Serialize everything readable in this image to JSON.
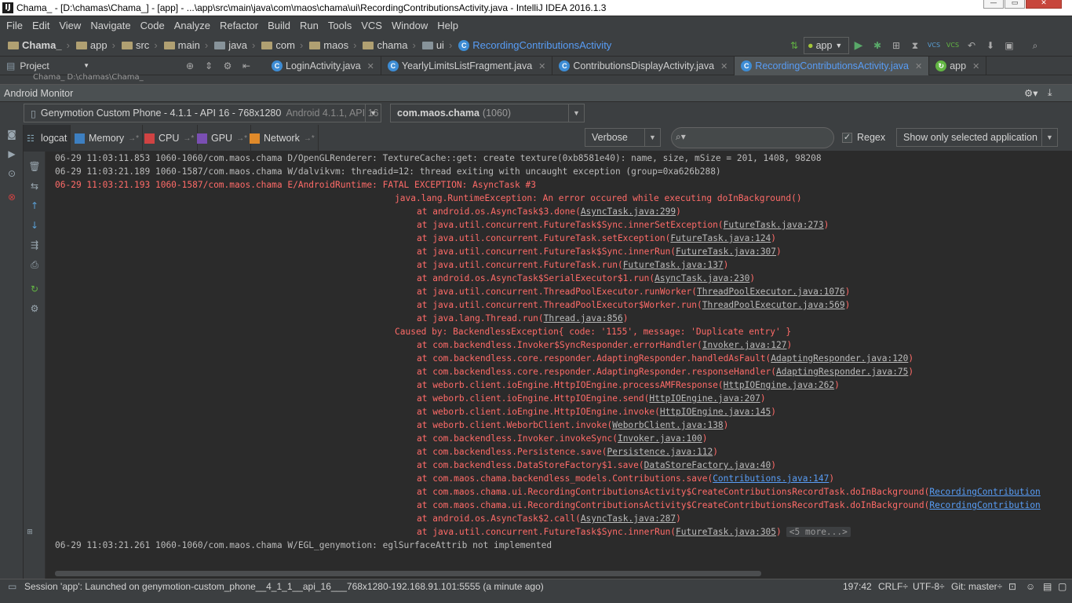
{
  "window": {
    "title": "Chama_ - [D:\\chamas\\Chama_] - [app] - ...\\app\\src\\main\\java\\com\\maos\\chama\\ui\\RecordingContributionsActivity.java - IntelliJ IDEA 2016.1.3",
    "app_icon": "IJ"
  },
  "menu": [
    "File",
    "Edit",
    "View",
    "Navigate",
    "Code",
    "Analyze",
    "Refactor",
    "Build",
    "Run",
    "Tools",
    "VCS",
    "Window",
    "Help"
  ],
  "breadcrumbs": [
    "Chama_",
    "app",
    "src",
    "main",
    "java",
    "com",
    "maos",
    "chama",
    "ui",
    "RecordingContributionsActivity"
  ],
  "run_config": "app",
  "project_panel": {
    "label": "Project",
    "path_preview": "Chama_  D:\\chamas\\Chama_"
  },
  "editor_tabs": [
    {
      "label": "LoginActivity.java",
      "active": false
    },
    {
      "label": "YearlyLimitsListFragment.java",
      "active": false
    },
    {
      "label": "ContributionsDisplayActivity.java",
      "active": false
    },
    {
      "label": "RecordingContributionsActivity.java",
      "active": true
    },
    {
      "label": "app",
      "active": false
    }
  ],
  "monitor": {
    "title": "Android Monitor",
    "device": "Genymotion Custom Phone - 4.1.1 - API 16 - 768x1280",
    "device_suffix": "Android 4.1.1, API 16",
    "process": "com.maos.chama",
    "process_pid": "(1060)",
    "tabs": [
      "logcat",
      "Memory",
      "CPU",
      "GPU",
      "Network"
    ],
    "log_level": "Verbose",
    "regex_label": "Regex",
    "regex_checked": true,
    "filter": "Show only selected application"
  },
  "log_lines": [
    {
      "text": "06-29 11:03:11.853 1060-1060/com.maos.chama D/OpenGLRenderer: TextureCache::get: create texture(0xb8581e40): name, size, mSize = 201, 1408, 98208",
      "level": "d"
    },
    {
      "text": "06-29 11:03:21.189 1060-1587/com.maos.chama W/dalvikvm: threadid=12: thread exiting with uncaught exception (group=0xa626b288)",
      "level": "d"
    },
    {
      "text": "06-29 11:03:21.193 1060-1587/com.maos.chama E/AndroidRuntime: FATAL EXCEPTION: AsyncTask #3",
      "level": "e"
    },
    {
      "text": "java.lang.RuntimeException: An error occured while executing doInBackground()",
      "level": "e",
      "indent": 1
    },
    {
      "prefix": "at android.os.AsyncTask$3.done(",
      "link": "AsyncTask.java:299",
      "suffix": ")",
      "level": "e",
      "indent": 2
    },
    {
      "prefix": "at java.util.concurrent.FutureTask$Sync.innerSetException(",
      "link": "FutureTask.java:273",
      "suffix": ")",
      "level": "e",
      "indent": 2
    },
    {
      "prefix": "at java.util.concurrent.FutureTask.setException(",
      "link": "FutureTask.java:124",
      "suffix": ")",
      "level": "e",
      "indent": 2
    },
    {
      "prefix": "at java.util.concurrent.FutureTask$Sync.innerRun(",
      "link": "FutureTask.java:307",
      "suffix": ")",
      "level": "e",
      "indent": 2
    },
    {
      "prefix": "at java.util.concurrent.FutureTask.run(",
      "link": "FutureTask.java:137",
      "suffix": ")",
      "level": "e",
      "indent": 2
    },
    {
      "prefix": "at android.os.AsyncTask$SerialExecutor$1.run(",
      "link": "AsyncTask.java:230",
      "suffix": ")",
      "level": "e",
      "indent": 2
    },
    {
      "prefix": "at java.util.concurrent.ThreadPoolExecutor.runWorker(",
      "link": "ThreadPoolExecutor.java:1076",
      "suffix": ")",
      "level": "e",
      "indent": 2
    },
    {
      "prefix": "at java.util.concurrent.ThreadPoolExecutor$Worker.run(",
      "link": "ThreadPoolExecutor.java:569",
      "suffix": ")",
      "level": "e",
      "indent": 2
    },
    {
      "prefix": "at java.lang.Thread.run(",
      "link": "Thread.java:856",
      "suffix": ")",
      "level": "e",
      "indent": 2
    },
    {
      "text": "Caused by: BackendlessException{ code: '1155', message: 'Duplicate entry' }",
      "level": "e",
      "indent": 1
    },
    {
      "prefix": "at com.backendless.Invoker$SyncResponder.errorHandler(",
      "link": "Invoker.java:127",
      "suffix": ")",
      "level": "e",
      "indent": 2
    },
    {
      "prefix": "at com.backendless.core.responder.AdaptingResponder.handledAsFault(",
      "link": "AdaptingResponder.java:120",
      "suffix": ")",
      "level": "e",
      "indent": 2
    },
    {
      "prefix": "at com.backendless.core.responder.AdaptingResponder.responseHandler(",
      "link": "AdaptingResponder.java:75",
      "suffix": ")",
      "level": "e",
      "indent": 2
    },
    {
      "prefix": "at weborb.client.ioEngine.HttpIOEngine.processAMFResponse(",
      "link": "HttpIOEngine.java:262",
      "suffix": ")",
      "level": "e",
      "indent": 2
    },
    {
      "prefix": "at weborb.client.ioEngine.HttpIOEngine.send(",
      "link": "HttpIOEngine.java:207",
      "suffix": ")",
      "level": "e",
      "indent": 2
    },
    {
      "prefix": "at weborb.client.ioEngine.HttpIOEngine.invoke(",
      "link": "HttpIOEngine.java:145",
      "suffix": ")",
      "level": "e",
      "indent": 2
    },
    {
      "prefix": "at weborb.client.WeborbClient.invoke(",
      "link": "WeborbClient.java:138",
      "suffix": ")",
      "level": "e",
      "indent": 2
    },
    {
      "prefix": "at com.backendless.Invoker.invokeSync(",
      "link": "Invoker.java:100",
      "suffix": ")",
      "level": "e",
      "indent": 2
    },
    {
      "prefix": "at com.backendless.Persistence.save(",
      "link": "Persistence.java:112",
      "suffix": ")",
      "level": "e",
      "indent": 2
    },
    {
      "prefix": "at com.backendless.DataStoreFactory$1.save(",
      "link": "DataStoreFactory.java:40",
      "suffix": ")",
      "level": "e",
      "indent": 2
    },
    {
      "prefix": "at com.maos.chama.backendless_models.Contributions.save(",
      "link": "Contributions.java:147",
      "suffix": ")",
      "level": "e",
      "indent": 2,
      "blue": true
    },
    {
      "prefix": "at com.maos.chama.ui.RecordingContributionsActivity$CreateContributionsRecordTask.doInBackground(",
      "link": "RecordingContribution",
      "suffix": "",
      "level": "e",
      "indent": 2,
      "blue": true
    },
    {
      "prefix": "at com.maos.chama.ui.RecordingContributionsActivity$CreateContributionsRecordTask.doInBackground(",
      "link": "RecordingContribution",
      "suffix": "",
      "level": "e",
      "indent": 2,
      "blue": true
    },
    {
      "prefix": "at android.os.AsyncTask$2.call(",
      "link": "AsyncTask.java:287",
      "suffix": ")",
      "level": "e",
      "indent": 2
    },
    {
      "prefix": "at java.util.concurrent.FutureTask$Sync.innerRun(",
      "link": "FutureTask.java:305",
      "suffix": ")",
      "level": "e",
      "indent": 2,
      "more": "<5 more...>"
    },
    {
      "text": "06-29 11:03:21.261 1060-1060/com.maos.chama W/EGL_genymotion: eglSurfaceAttrib not implemented",
      "level": "d"
    }
  ],
  "status": {
    "message": "Session 'app': Launched on genymotion-custom_phone__4_1_1__api_16___768x1280-192.168.91.101:5555 (a minute ago)",
    "position": "197:42",
    "line_sep": "CRLF÷",
    "encoding": "UTF-8÷",
    "git": "Git: master÷"
  },
  "colors": {
    "error": "#ff6b68",
    "debug": "#bbbbbb",
    "link_blue": "#589df6",
    "panel_bg": "#3c3f41",
    "console_bg": "#2b2b2b"
  }
}
